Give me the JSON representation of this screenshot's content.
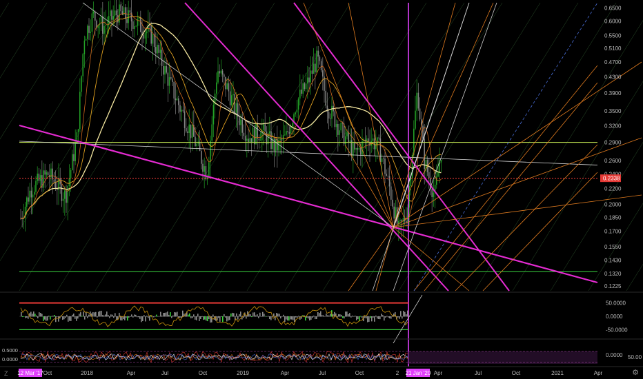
{
  "chart_data": {
    "type": "candlestick",
    "price_axis": {
      "ticks": [
        "0.6500",
        "0.6000",
        "0.5500",
        "0.5100",
        "0.4700",
        "0.4300",
        "0.3900",
        "0.3500",
        "0.3200",
        "0.2900",
        "0.2600",
        "0.2400",
        "0.2200",
        "0.2000",
        "0.1850",
        "0.1700",
        "0.1550",
        "0.1430",
        "0.1320",
        "0.1225"
      ],
      "scale": "log",
      "range": [
        0.119,
        0.67
      ],
      "current_price": "0.2338",
      "current_color": "#e53935"
    },
    "time_axis": {
      "labels": [
        "12 Mar '17",
        "Oct",
        "2018",
        "Apr",
        "Jul",
        "Oct",
        "2019",
        "Apr",
        "Jul",
        "Oct",
        "2",
        "21 Jan '20",
        "Apr",
        "Jul",
        "Oct",
        "2021",
        "Apr"
      ],
      "start_date": "12 Mar '17",
      "marker_date": "21 Jan '20",
      "marker_color": "#e040fb"
    },
    "horizontal_levels": [
      {
        "price": 0.29,
        "color": "#b7d94c"
      },
      {
        "price": 0.2338,
        "color": "#e53935",
        "style": "dotted"
      },
      {
        "price": 0.1335,
        "color": "#35c33a"
      }
    ],
    "oscillator": {
      "ticks": [
        "50.0000",
        "0.0000",
        "-50.0000"
      ],
      "upper_band": 50,
      "lower_band": -50,
      "upper_color": "#e53935",
      "lower_color": "#35c33a"
    },
    "bottom_indicator": {
      "ticks": [
        "0.5000",
        "0.0000"
      ],
      "right_ticks": [
        "0.0000",
        "50.00"
      ]
    },
    "colors": {
      "background": "#000000",
      "up_candle": "#26a829",
      "down_candle": "#8a8a8a",
      "trend_magenta": "#e52bd2",
      "fan_orange": "#e07b1f",
      "ma_yellow": "#f4e7a0"
    }
  },
  "ui": {
    "settings_icon": "gear-icon",
    "timezone_label": "Z"
  }
}
